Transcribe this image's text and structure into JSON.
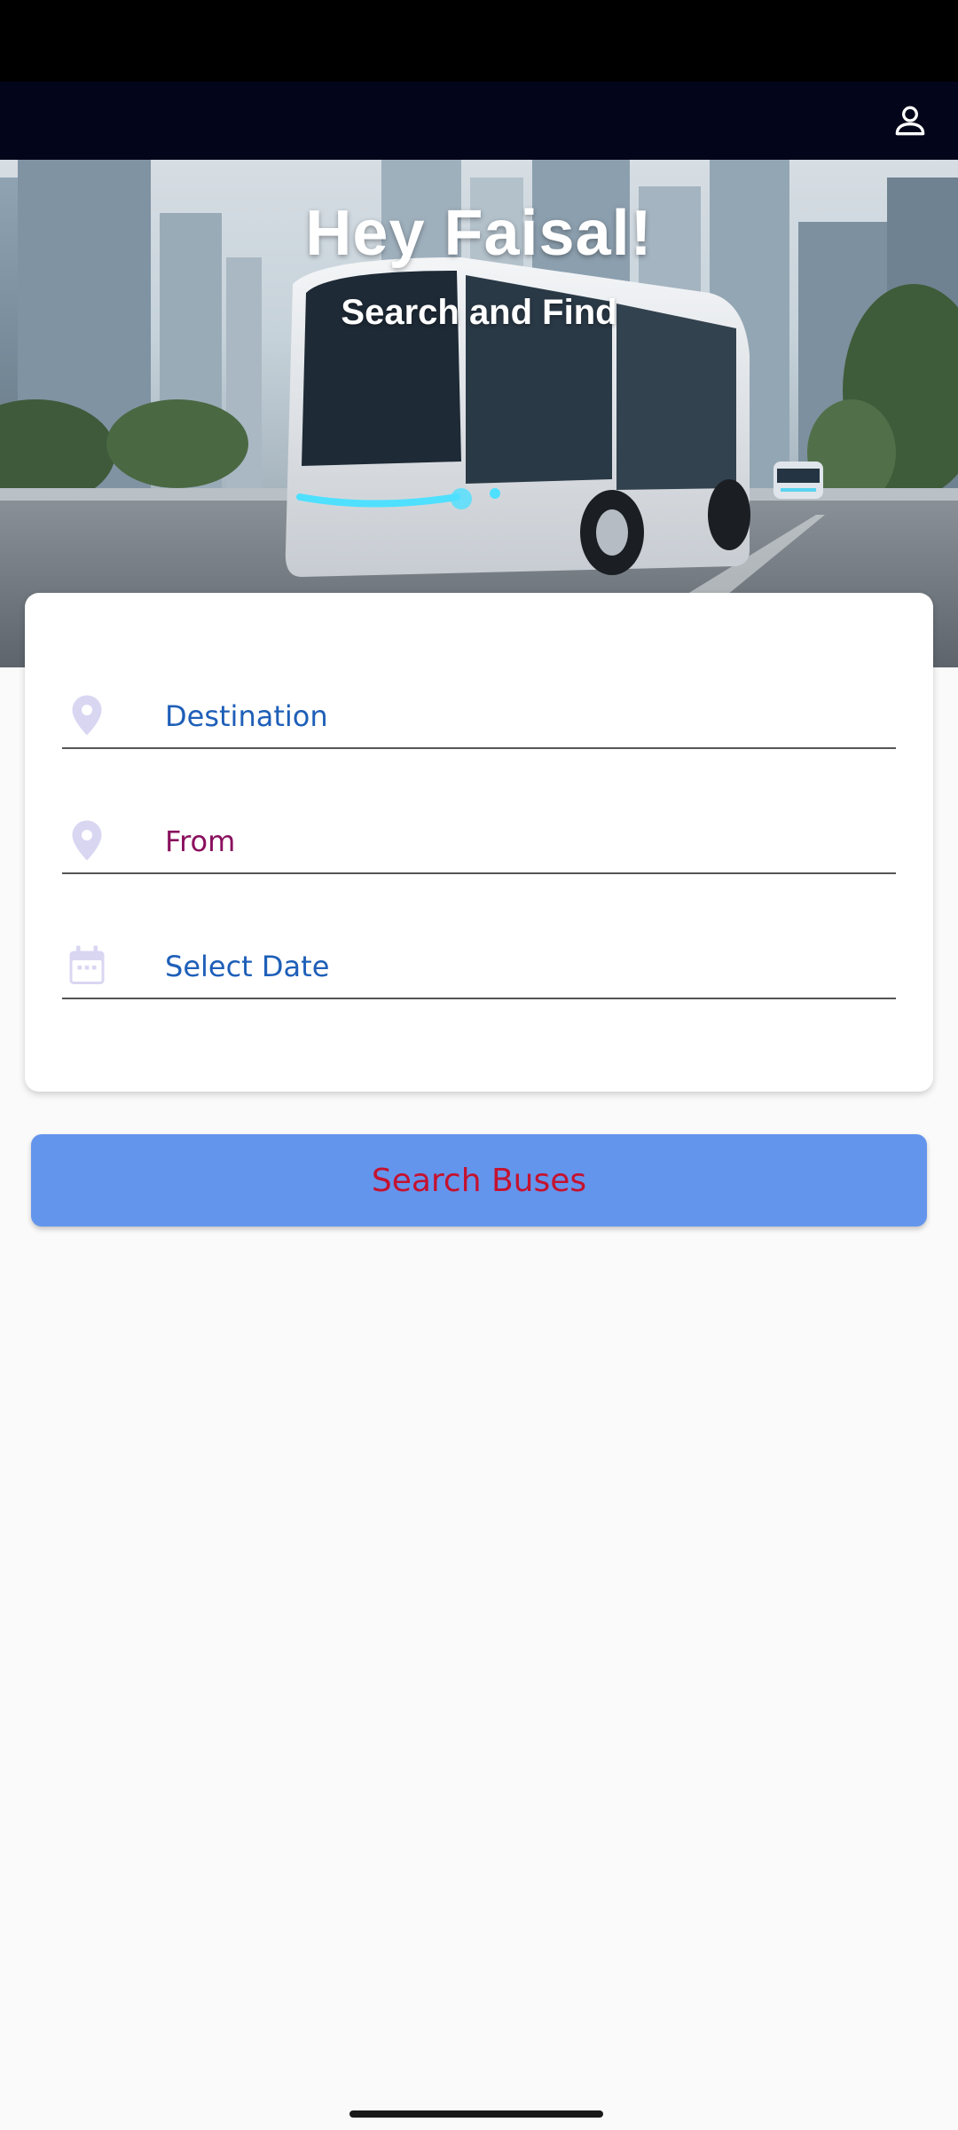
{
  "hero": {
    "title": "Hey Faisal!",
    "subtitle": "Search and Find"
  },
  "form": {
    "destination_label": "Destination",
    "from_label": "From",
    "date_label": "Select Date"
  },
  "actions": {
    "search_label": "Search Buses"
  },
  "icons": {
    "profile": "person-outline-icon",
    "destination": "location-pin-icon",
    "from": "location-pin-icon",
    "date": "calendar-icon"
  },
  "colors": {
    "app_bar": "#03061a",
    "button_bg": "#6495ed",
    "button_text": "#c4122f",
    "field_text_blue": "#1e5fb8",
    "field_text_purple": "#8a0f5e",
    "icon_tint": "#d9d6f2"
  }
}
